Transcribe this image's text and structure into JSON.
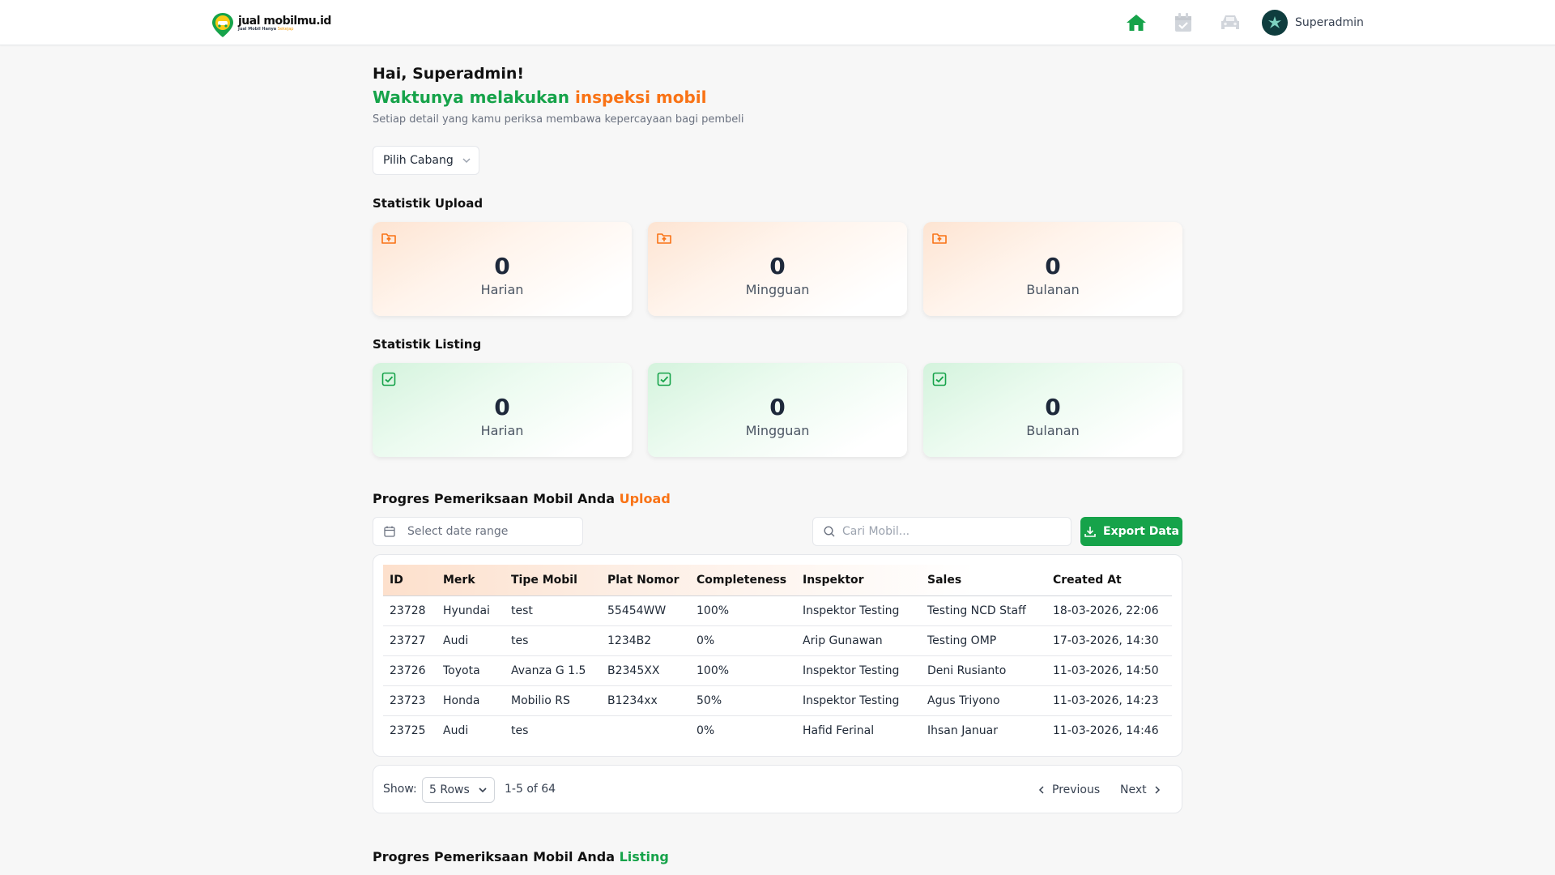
{
  "header": {
    "logo_title": "jual mobilmu.id",
    "logo_tagline": "Jual Mobil Hanya",
    "logo_tagline_accent": "Sekejap",
    "nav": [
      {
        "icon": "home-icon",
        "active": true
      },
      {
        "icon": "calendar-check-icon",
        "active": false
      },
      {
        "icon": "car-icon",
        "active": false
      }
    ],
    "user_name": "Superadmin"
  },
  "hero": {
    "greeting": "Hai, Superadmin!",
    "headline_green": "Waktunya melakukan",
    "headline_orange": "inspeksi mobil",
    "subtitle": "Setiap detail yang kamu periksa membawa kepercayaan bagi pembeli"
  },
  "branch_select": {
    "label": "Pilih Cabang"
  },
  "upload_stats": {
    "title": "Statistik Upload",
    "cards": [
      {
        "value": "0",
        "label": "Harian"
      },
      {
        "value": "0",
        "label": "Mingguan"
      },
      {
        "value": "0",
        "label": "Bulanan"
      }
    ]
  },
  "listing_stats": {
    "title": "Statistik Listing",
    "cards": [
      {
        "value": "0",
        "label": "Harian"
      },
      {
        "value": "0",
        "label": "Mingguan"
      },
      {
        "value": "0",
        "label": "Bulanan"
      }
    ]
  },
  "upload_progress": {
    "title": "Progres Pemeriksaan Mobil Anda",
    "title_accent": "Upload",
    "date_placeholder": "Select date range",
    "search_placeholder": "Cari Mobil...",
    "export_label": "Export Data",
    "columns": [
      "ID",
      "Merk",
      "Tipe Mobil",
      "Plat Nomor",
      "Completeness",
      "Inspektor",
      "Sales",
      "Created At"
    ],
    "rows": [
      [
        "23728",
        "Hyundai",
        "test",
        "55454WW",
        "100%",
        "Inspektor Testing",
        "Testing NCD Staff",
        "18-03-2026, 22:06"
      ],
      [
        "23727",
        "Audi",
        "tes",
        "1234B2",
        "0%",
        "Arip Gunawan",
        "Testing OMP",
        "17-03-2026, 14:30"
      ],
      [
        "23726",
        "Toyota",
        "Avanza G 1.5",
        "B2345XX",
        "100%",
        "Inspektor Testing",
        "Deni Rusianto",
        "11-03-2026, 14:50"
      ],
      [
        "23723",
        "Honda",
        "Mobilio RS",
        "B1234xx",
        "50%",
        "Inspektor Testing",
        "Agus Triyono",
        "11-03-2026, 14:23"
      ],
      [
        "23725",
        "Audi",
        "tes",
        "",
        "0%",
        "Hafid Ferinal",
        "Ihsan Januar",
        "11-03-2026, 14:46"
      ]
    ],
    "pagination": {
      "show_label": "Show:",
      "rows_option": "5 Rows",
      "range": "1-5 of 64",
      "prev_label": "Previous",
      "next_label": "Next"
    }
  },
  "listing_progress": {
    "title": "Progres Pemeriksaan Mobil Anda",
    "title_accent": "Listing"
  },
  "colors": {
    "green": "#16a34a",
    "orange": "#f97316"
  }
}
